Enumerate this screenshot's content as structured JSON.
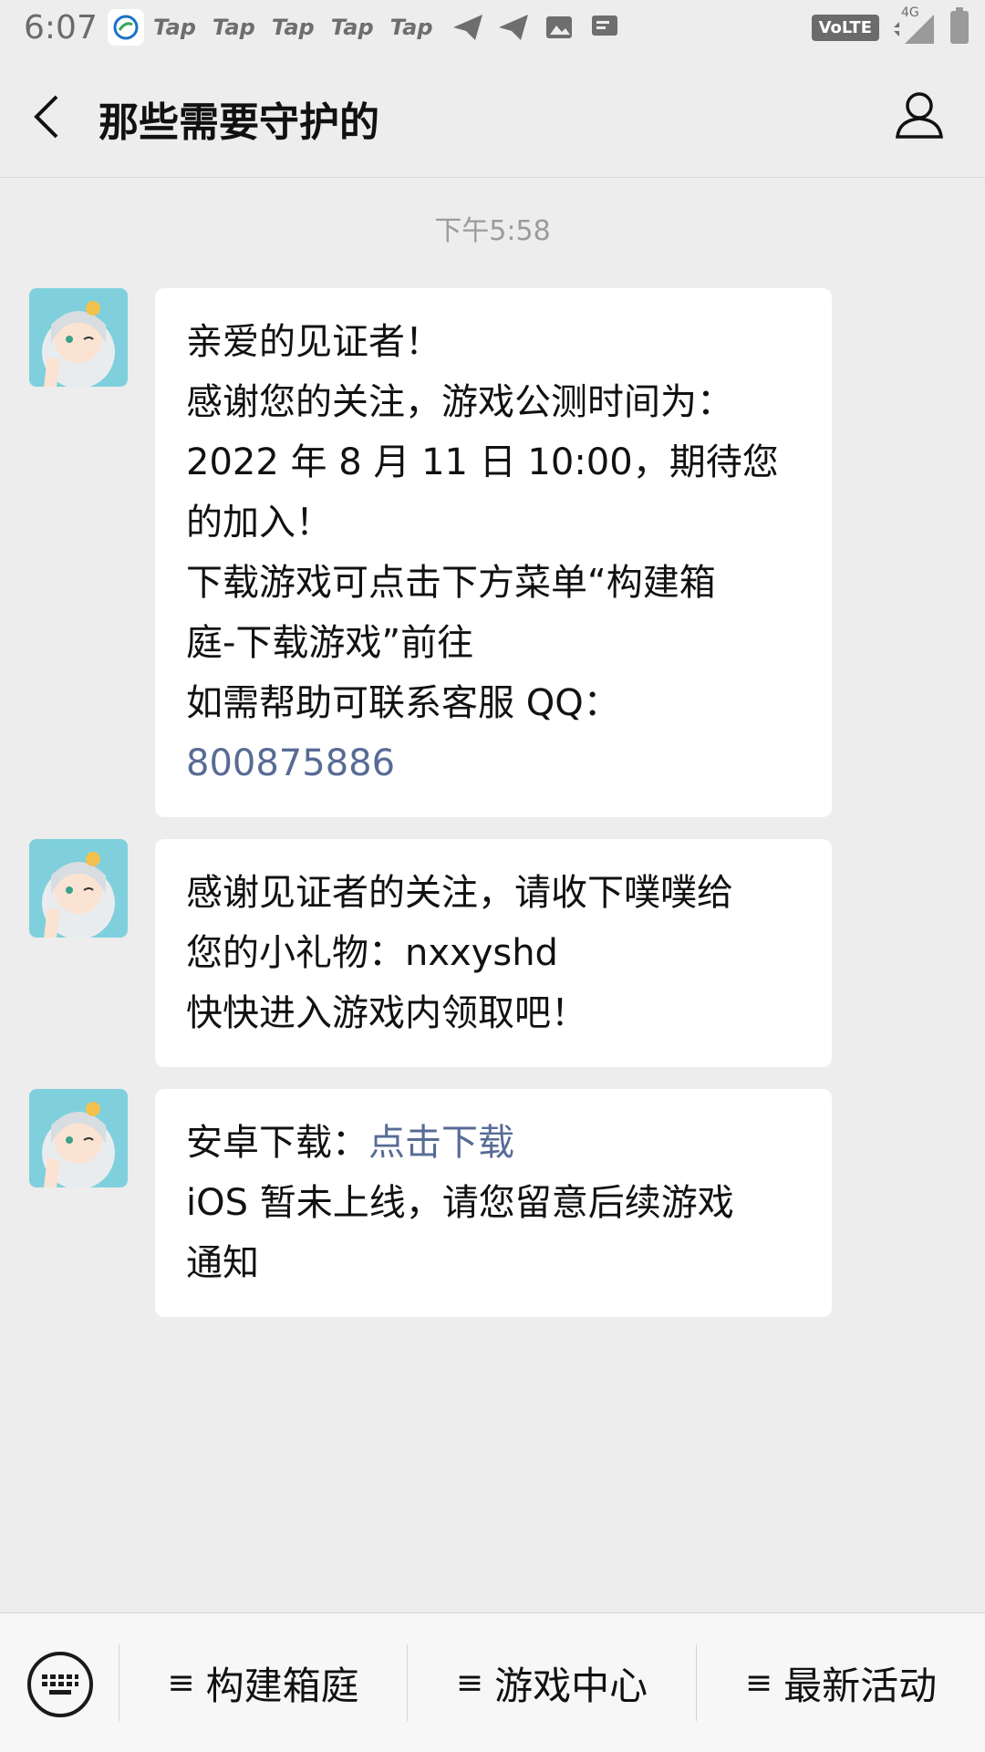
{
  "status_bar": {
    "time": "6:07",
    "tap_labels": [
      "Tap",
      "Tap",
      "Tap",
      "Tap",
      "Tap"
    ],
    "volte": "VoLTE",
    "network": "4G"
  },
  "header": {
    "title": "那些需要守护的"
  },
  "chat": {
    "timestamp": "下午5:58",
    "messages": [
      {
        "lines": [
          "亲爱的见证者！",
          "感谢您的关注，游戏公测时间为：",
          "2022 年 8 月 11 日 10:00，期待您",
          "的加入！",
          "下载游戏可点击下方菜单“构建箱",
          "庭-下载游戏”前往",
          "如需帮助可联系客服 QQ："
        ],
        "link": "800875886"
      },
      {
        "lines": [
          "感谢见证者的关注，请收下噗噗给",
          "您的小礼物：nxxyshd",
          "快快进入游戏内领取吧！"
        ]
      },
      {
        "prefix": "安卓下载：",
        "link": "点击下载",
        "lines": [
          "iOS 暂未上线，请您留意后续游戏",
          "通知"
        ]
      }
    ]
  },
  "bottom_menu": {
    "items": [
      {
        "icon": "≡",
        "label": "构建箱庭"
      },
      {
        "icon": "≡",
        "label": "游戏中心"
      },
      {
        "icon": "≡",
        "label": "最新活动"
      }
    ]
  },
  "colors": {
    "background": "#ededed",
    "bubble": "#ffffff",
    "link": "#576b95",
    "timestamp": "#9b9b9b"
  }
}
